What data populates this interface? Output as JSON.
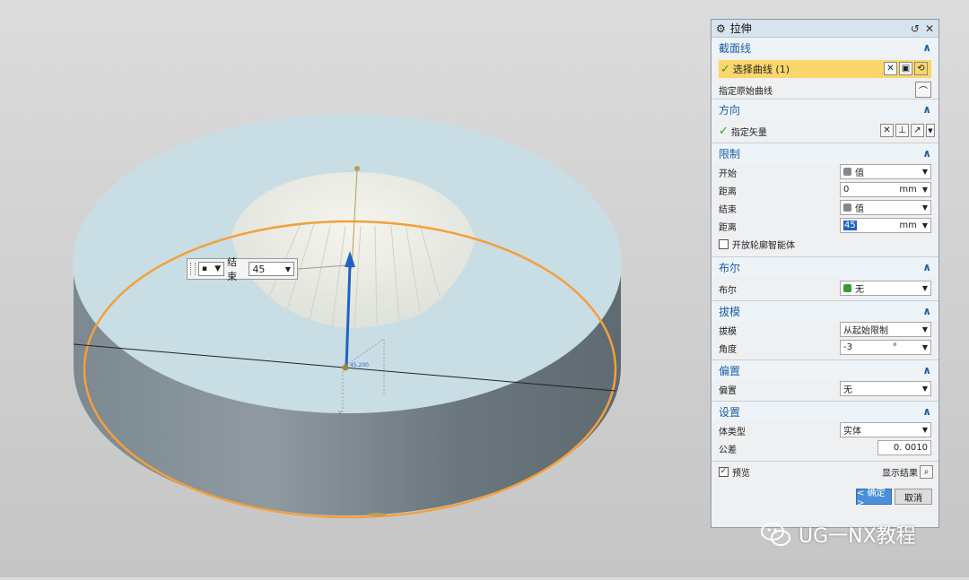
{
  "viewport": {
    "annotation": "45.200",
    "colors": {
      "top_face": "#c8dce4",
      "side": "#7e8b93",
      "edge_highlight": "#f4a03a",
      "vector": "#1e63c8"
    }
  },
  "osi": {
    "label": "结束",
    "value": "45"
  },
  "dialog": {
    "title": "拉伸",
    "sections": {
      "section_curve": {
        "title": "截面线",
        "select_curve": "选择曲线 (1)",
        "specify_origin": "指定原始曲线"
      },
      "direction": {
        "title": "方向",
        "specify_vector": "指定矢量"
      },
      "limits": {
        "title": "限制",
        "start_label": "开始",
        "start_value": "值",
        "dist1_label": "距离",
        "dist1_value": "0",
        "dist1_unit": "mm",
        "end_label": "结束",
        "end_value": "值",
        "dist2_label": "距离",
        "dist2_value": "45",
        "dist2_unit": "mm",
        "open_profile": "开放轮廓智能体"
      },
      "boolean": {
        "title": "布尔",
        "label": "布尔",
        "value": "无"
      },
      "draft": {
        "title": "拔模",
        "label": "拔模",
        "value": "从起始限制",
        "angle_label": "角度",
        "angle_value": "-3",
        "angle_unit": "°"
      },
      "offset": {
        "title": "偏置",
        "label": "偏置",
        "value": "无"
      },
      "settings": {
        "title": "设置",
        "body_type_label": "体类型",
        "body_type_value": "实体",
        "tolerance_label": "公差",
        "tolerance_value": "0. 0010"
      }
    },
    "footer": {
      "preview": "预览",
      "show_result": "显示结果",
      "ok": "< 确定 >",
      "cancel": "取消"
    }
  },
  "watermark": {
    "text": "UG一NX教程"
  }
}
